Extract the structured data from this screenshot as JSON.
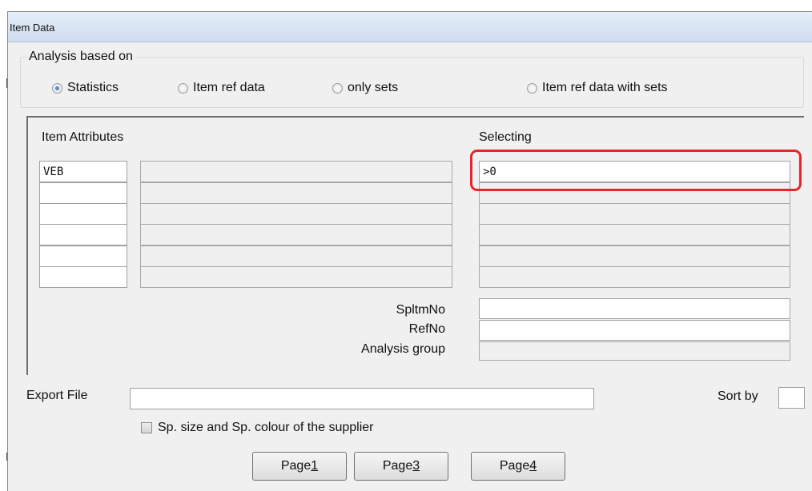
{
  "window": {
    "title": "Item Data"
  },
  "analysis": {
    "legend": "Analysis based on",
    "options": [
      {
        "label": "Statistics",
        "selected": true
      },
      {
        "label": "Item ref data",
        "selected": false
      },
      {
        "label": "only sets",
        "selected": false
      },
      {
        "label": "Item ref data with sets",
        "selected": false
      }
    ]
  },
  "attributes": {
    "header": "Item Attributes",
    "selecting_header": "Selecting",
    "rows": [
      {
        "code": "VEB",
        "description": "",
        "selecting": ">0"
      },
      {
        "code": "",
        "description": "",
        "selecting": ""
      },
      {
        "code": "",
        "description": "",
        "selecting": ""
      },
      {
        "code": "",
        "description": "",
        "selecting": ""
      },
      {
        "code": "",
        "description": "",
        "selecting": ""
      },
      {
        "code": "",
        "description": "",
        "selecting": ""
      }
    ]
  },
  "fields": {
    "spltmno": {
      "label": "SpltmNo",
      "value": ""
    },
    "refno": {
      "label": "RefNo",
      "value": ""
    },
    "analysis_group": {
      "label": "Analysis group",
      "value": ""
    }
  },
  "export": {
    "label": "Export File",
    "value": ""
  },
  "sort": {
    "label": "Sort by",
    "value": ""
  },
  "supplier_option": {
    "label": "Sp. size and Sp. colour of the supplier",
    "checked": false
  },
  "buttons": {
    "page1": {
      "prefix": "Page ",
      "key": "1"
    },
    "page3": {
      "prefix": "Page ",
      "key": "3"
    },
    "page4": {
      "prefix": "Page ",
      "key": "4"
    }
  },
  "colors": {
    "highlight": "#e8252a",
    "titlebar": "#cfdcef",
    "radio_selected": "#1f5fa8"
  }
}
